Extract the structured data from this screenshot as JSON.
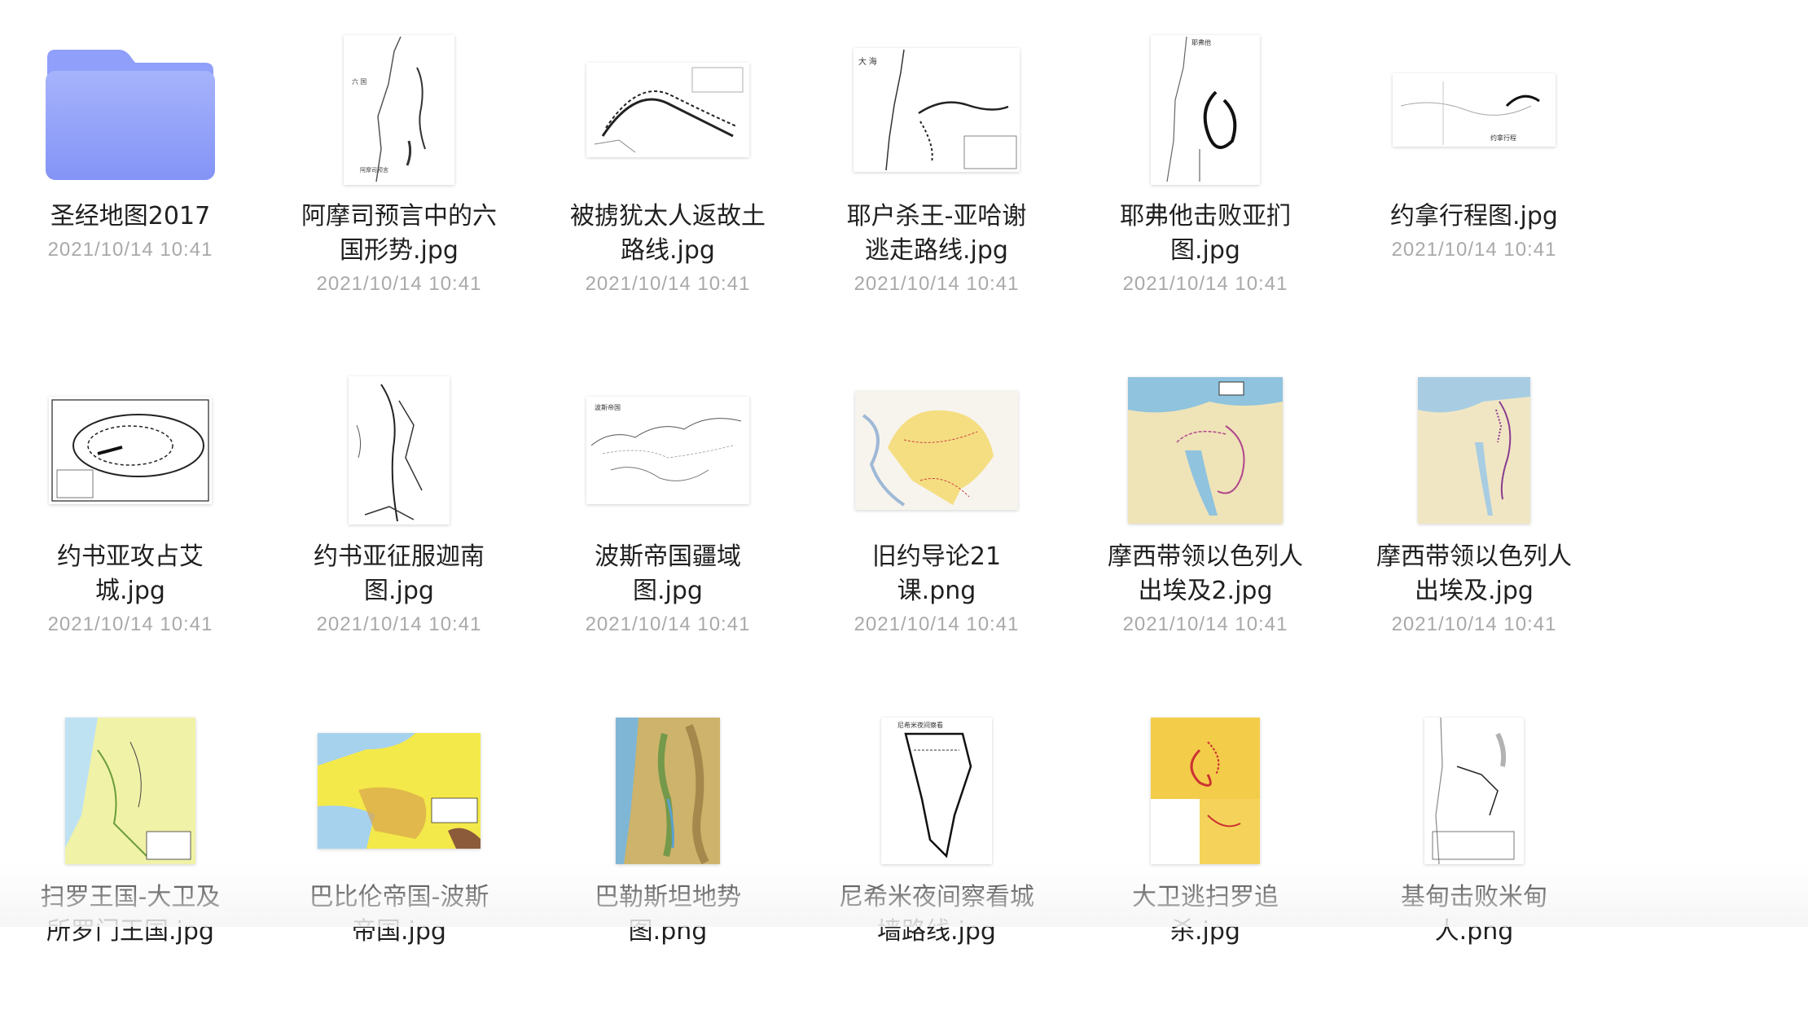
{
  "files": [
    {
      "name": "圣经地图2017",
      "date": "2021/10/14 10:41",
      "icon": "folder-icon"
    },
    {
      "name": "阿摩司预言中的六\n国形势.jpg",
      "date": "2021/10/14 10:41",
      "icon": "map-thumbnail"
    },
    {
      "name": "被掳犹太人返故土\n路线.jpg",
      "date": "2021/10/14 10:41",
      "icon": "map-thumbnail"
    },
    {
      "name": "耶户杀王-亚哈谢\n逃走路线.jpg",
      "date": "2021/10/14 10:41",
      "icon": "map-thumbnail"
    },
    {
      "name": "耶弗他击败亚扪\n图.jpg",
      "date": "2021/10/14 10:41",
      "icon": "map-thumbnail"
    },
    {
      "name": "约拿行程图.jpg",
      "date": "2021/10/14 10:41",
      "icon": "map-thumbnail"
    },
    {
      "name": "约书亚攻占艾\n城.jpg",
      "date": "2021/10/14 10:41",
      "icon": "map-thumbnail"
    },
    {
      "name": "约书亚征服迦南\n图.jpg",
      "date": "2021/10/14 10:41",
      "icon": "map-thumbnail"
    },
    {
      "name": "波斯帝国疆域\n图.jpg",
      "date": "2021/10/14 10:41",
      "icon": "map-thumbnail"
    },
    {
      "name": "旧约导论21\n课.png",
      "date": "2021/10/14 10:41",
      "icon": "map-thumbnail"
    },
    {
      "name": "摩西带领以色列人\n出埃及2.jpg",
      "date": "2021/10/14 10:41",
      "icon": "map-thumbnail"
    },
    {
      "name": "摩西带领以色列人\n出埃及.jpg",
      "date": "2021/10/14 10:41",
      "icon": "map-thumbnail"
    },
    {
      "name": "扫罗王国-大卫及\n所罗门王国.jpg",
      "date": "",
      "icon": "map-thumbnail"
    },
    {
      "name": "巴比伦帝国-波斯\n帝国.jpg",
      "date": "",
      "icon": "map-thumbnail"
    },
    {
      "name": "巴勒斯坦地势\n图.png",
      "date": "",
      "icon": "map-thumbnail"
    },
    {
      "name": "尼希米夜间察看城\n墙路线.jpg",
      "date": "",
      "icon": "map-thumbnail"
    },
    {
      "name": "大卫逃扫罗追\n杀.jpg",
      "date": "",
      "icon": "map-thumbnail"
    },
    {
      "name": "基甸击败米甸\n人.png",
      "date": "",
      "icon": "map-thumbnail"
    }
  ],
  "colors": {
    "folder_top": "#9aa9fb",
    "folder_bottom": "#8696f7",
    "date_text": "#a9a9a9"
  }
}
